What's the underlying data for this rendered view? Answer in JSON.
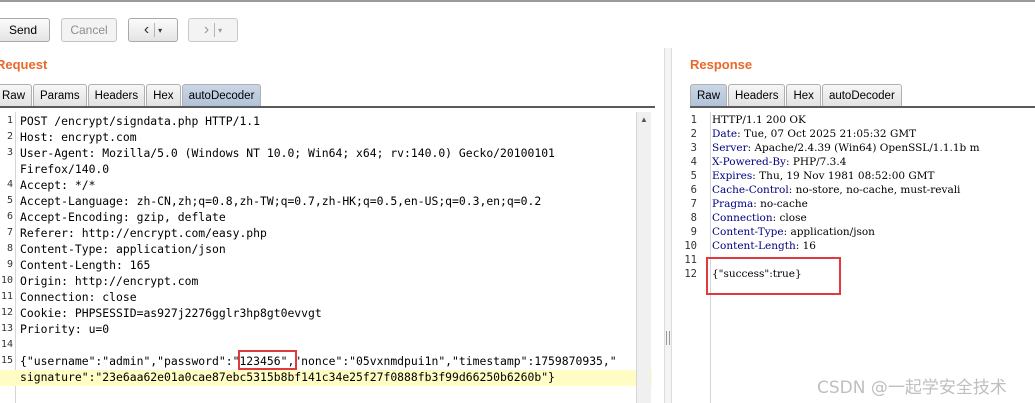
{
  "toolbar": {
    "send_label": "Send",
    "cancel_label": "Cancel",
    "back_icon": "‹",
    "forward_icon": "›",
    "dropdown_icon": "▾"
  },
  "request": {
    "title": "Request",
    "tabs": [
      "Raw",
      "Params",
      "Headers",
      "Hex",
      "autoDecoder"
    ],
    "active_tab": "autoDecoder",
    "lines": [
      {
        "n": "1",
        "text": "POST /encrypt/signdata.php HTTP/1.1"
      },
      {
        "n": "2",
        "text": "Host: encrypt.com"
      },
      {
        "n": "3",
        "text": "User-Agent: Mozilla/5.0 (Windows NT 10.0; Win64; x64; rv:140.0) Gecko/20100101"
      },
      {
        "n": "",
        "text": "Firefox/140.0"
      },
      {
        "n": "4",
        "text": "Accept: */*"
      },
      {
        "n": "5",
        "text": "Accept-Language: zh-CN,zh;q=0.8,zh-TW;q=0.7,zh-HK;q=0.5,en-US;q=0.3,en;q=0.2"
      },
      {
        "n": "6",
        "text": "Accept-Encoding: gzip, deflate"
      },
      {
        "n": "7",
        "text": "Referer: http://encrypt.com/easy.php"
      },
      {
        "n": "8",
        "text": "Content-Type: application/json"
      },
      {
        "n": "9",
        "text": "Content-Length: 165"
      },
      {
        "n": "10",
        "text": "Origin: http://encrypt.com"
      },
      {
        "n": "11",
        "text": "Connection: close"
      },
      {
        "n": "12",
        "text": "Cookie: PHPSESSID=as927j2276gglr3hp8gt0evvgt"
      },
      {
        "n": "13",
        "text": "Priority: u=0"
      },
      {
        "n": "14",
        "text": ""
      },
      {
        "n": "15",
        "text": "{\"username\":\"admin\",\"password\":\"123456\",\"nonce\":\"05vxnmdpui1n\",\"timestamp\":1759870935,\""
      },
      {
        "n": "",
        "text": "signature\":\"23e6aa62e01a0cae87ebc5315b8bf141c34e25f27f0888fb3f99d66250b6260b\"}"
      }
    ],
    "highlighted_value": "123456"
  },
  "response": {
    "title": "Response",
    "tabs": [
      "Raw",
      "Headers",
      "Hex",
      "autoDecoder"
    ],
    "active_tab": "Raw",
    "lines": [
      {
        "n": "1",
        "key": "",
        "text": "HTTP/1.1 200 OK"
      },
      {
        "n": "2",
        "key": "Date",
        "text": ": Tue, 07 Oct 2025 21:05:32 GMT"
      },
      {
        "n": "3",
        "key": "Server",
        "text": ": Apache/2.4.39 (Win64) OpenSSL/1.1.1b m"
      },
      {
        "n": "4",
        "key": "X-Powered-By",
        "text": ": PHP/7.3.4"
      },
      {
        "n": "5",
        "key": "Expires",
        "text": ": Thu, 19 Nov 1981 08:52:00 GMT"
      },
      {
        "n": "6",
        "key": "Cache-Control",
        "text": ": no-store, no-cache, must-revali"
      },
      {
        "n": "7",
        "key": "Pragma",
        "text": ": no-cache"
      },
      {
        "n": "8",
        "key": "Connection",
        "text": ": close"
      },
      {
        "n": "9",
        "key": "Content-Type",
        "text": ": application/json"
      },
      {
        "n": "10",
        "key": "Content-Length",
        "text": ": 16"
      },
      {
        "n": "11",
        "key": "",
        "text": ""
      },
      {
        "n": "12",
        "key": "",
        "text": "{\"success\":true}"
      }
    ]
  },
  "watermark": "CSDN @一起学安全技术"
}
